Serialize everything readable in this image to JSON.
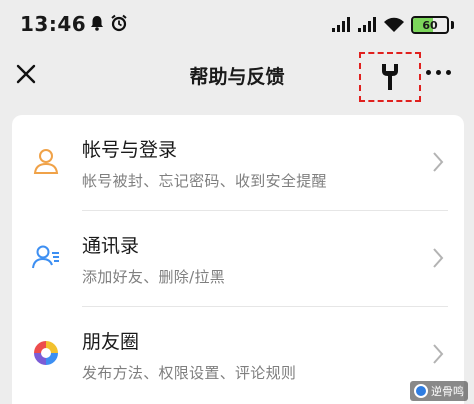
{
  "status_bar": {
    "time": "13:46",
    "battery": "60",
    "battery_level": 0.6
  },
  "nav": {
    "title": "帮助与反馈"
  },
  "menu": {
    "items": [
      {
        "title": "帐号与登录",
        "subtitle": "帐号被封、忘记密码、收到安全提醒",
        "icon": "user-icon"
      },
      {
        "title": "通讯录",
        "subtitle": "添加好友、删除/拉黑",
        "icon": "contacts-icon"
      },
      {
        "title": "朋友圈",
        "subtitle": "发布方法、权限设置、评论规则",
        "icon": "moments-icon"
      }
    ]
  },
  "watermark": {
    "text": "逆骨鸣"
  },
  "colors": {
    "accent_orange": "#f0a248",
    "accent_blue": "#3d8ff2",
    "highlight_red": "#e0201e"
  }
}
